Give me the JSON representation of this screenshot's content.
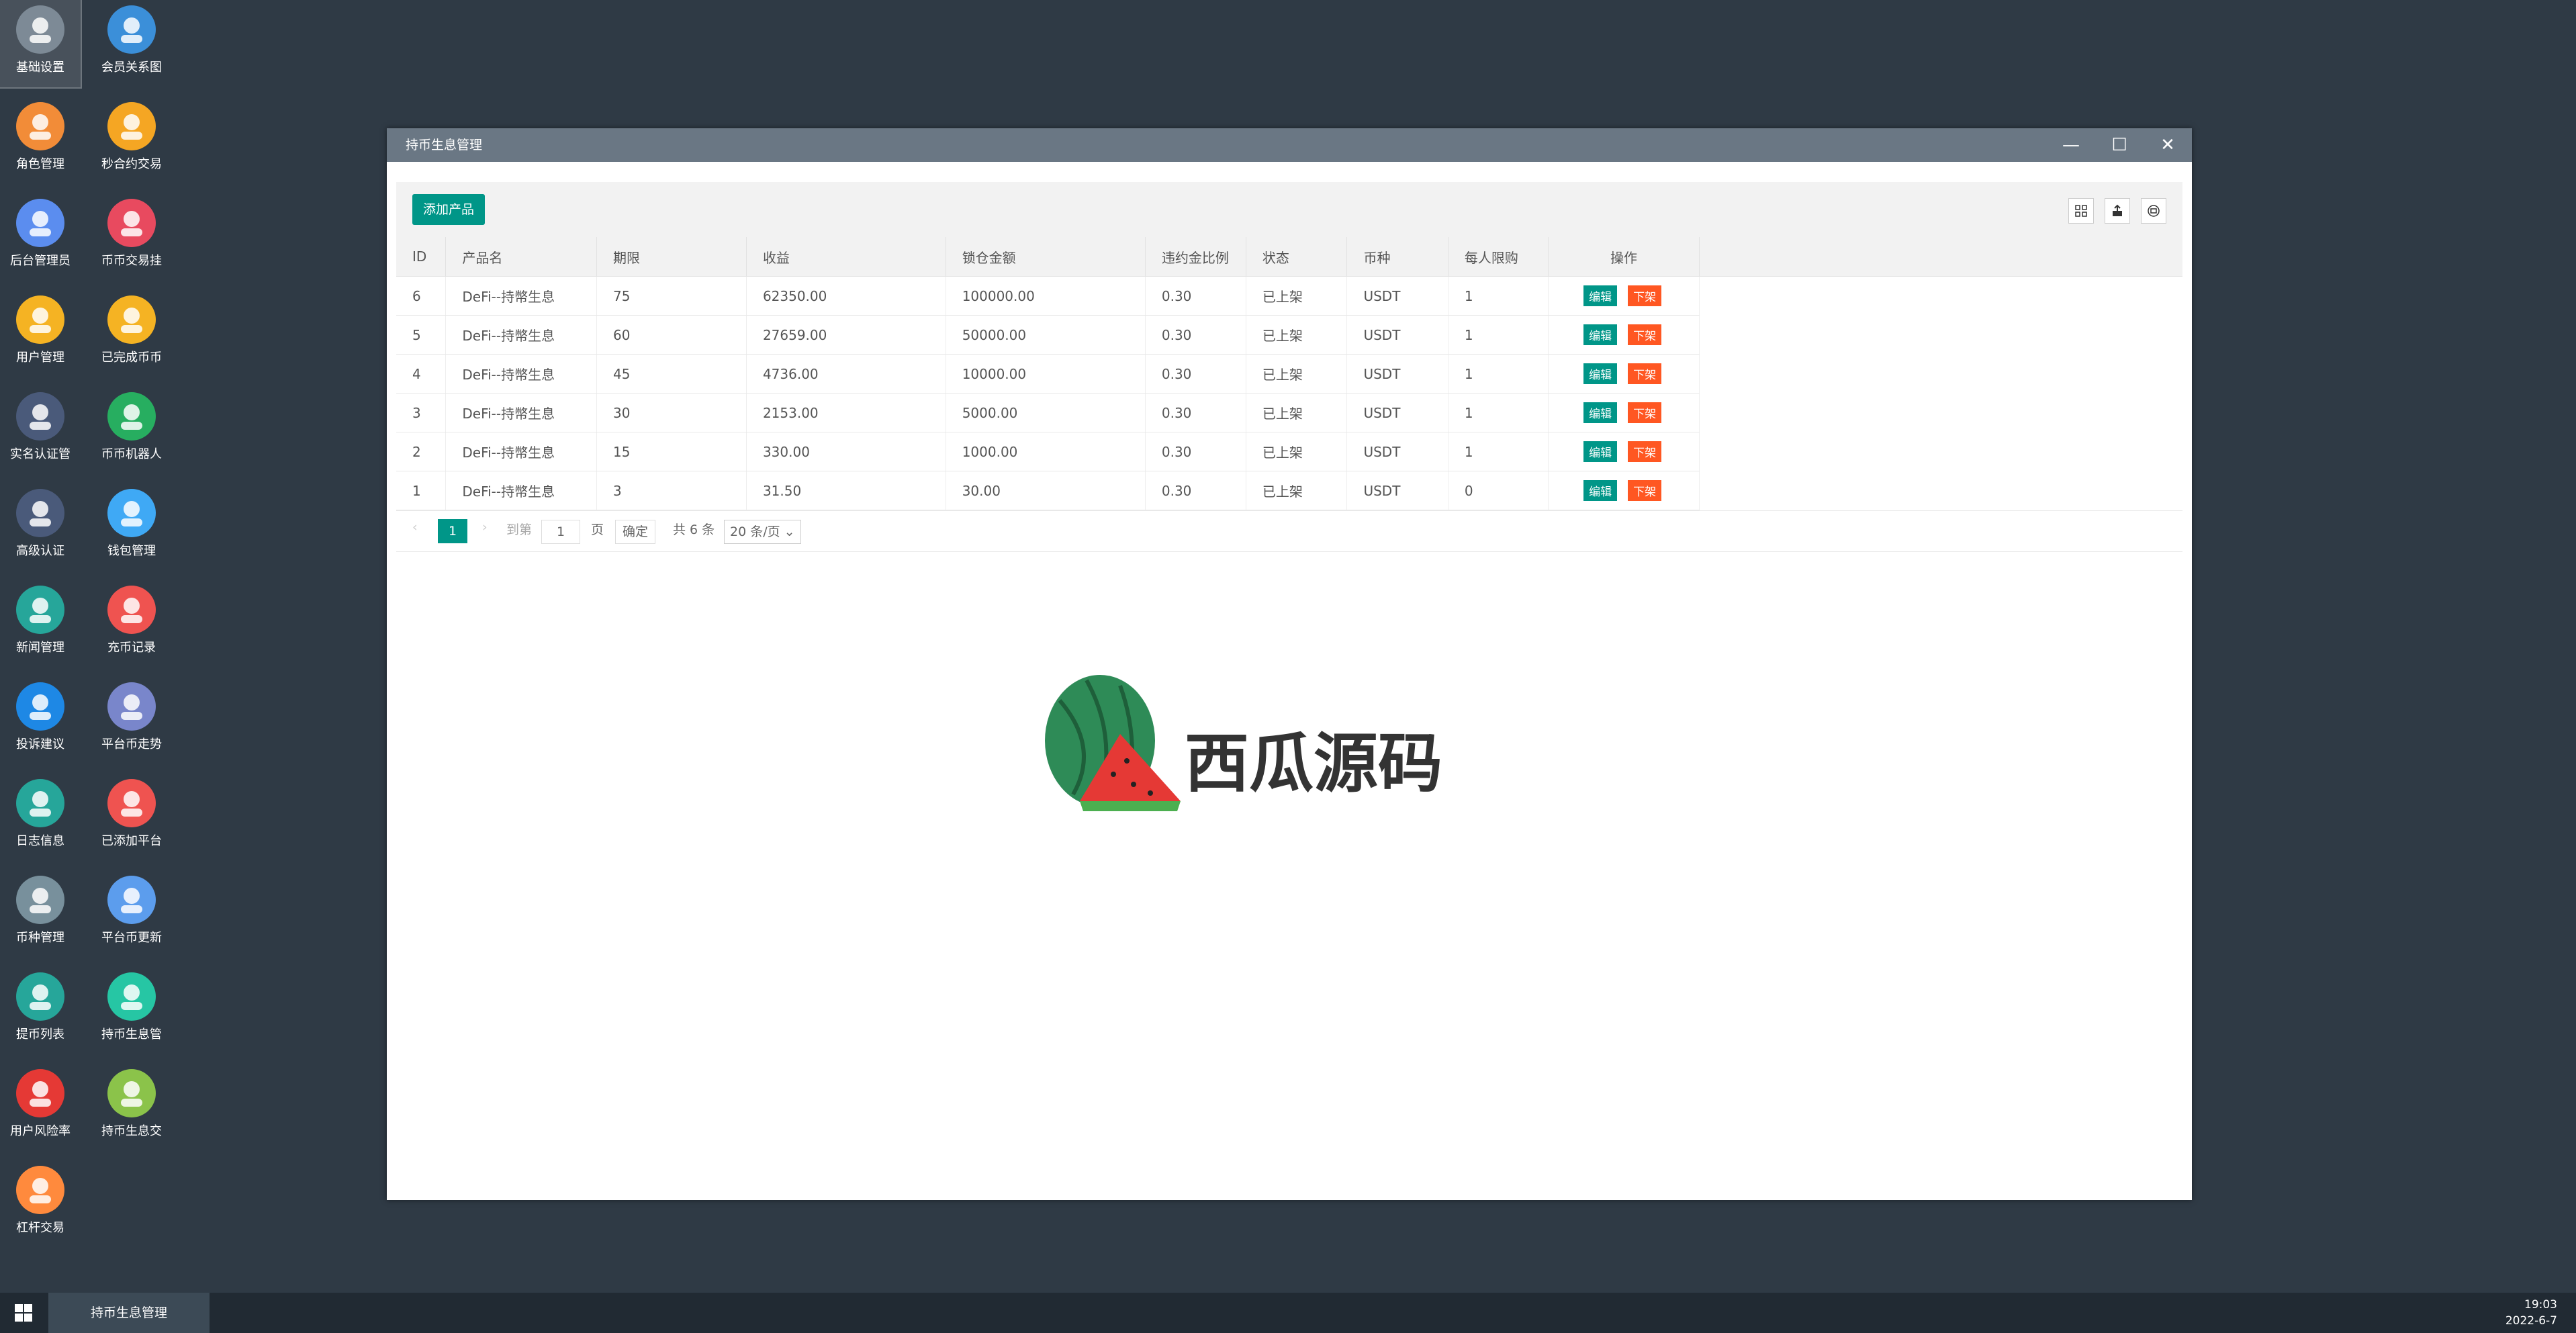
{
  "desktop_icons": [
    {
      "label": "基础设置",
      "icon": "gear-icon",
      "color": "#7d8a96"
    },
    {
      "label": "会员关系图",
      "icon": "network-icon",
      "color": "#3b8fd9"
    },
    {
      "label": "角色管理",
      "icon": "role-icon",
      "color": "#f28c38"
    },
    {
      "label": "秒合约交易",
      "icon": "stopwatch-icon",
      "color": "#f5a623"
    },
    {
      "label": "后台管理员",
      "icon": "admin-icon",
      "color": "#5b8def"
    },
    {
      "label": "币币交易挂",
      "icon": "bitcoin-icon",
      "color": "#e84a5f"
    },
    {
      "label": "用户管理",
      "icon": "user-search-icon",
      "color": "#f5b323"
    },
    {
      "label": "已完成币币",
      "icon": "check-icon",
      "color": "#f5b323"
    },
    {
      "label": "实名认证管",
      "icon": "id-verify-icon",
      "color": "#4a5a7a"
    },
    {
      "label": "币币机器人",
      "icon": "robot-icon",
      "color": "#27ae60"
    },
    {
      "label": "高级认证",
      "icon": "advanced-verify-icon",
      "color": "#4a5a7a"
    },
    {
      "label": "钱包管理",
      "icon": "wallet-icon",
      "color": "#3fa9f5"
    },
    {
      "label": "新闻管理",
      "icon": "news-icon",
      "color": "#26a69a"
    },
    {
      "label": "充币记录",
      "icon": "deposit-chart-icon",
      "color": "#ef5350"
    },
    {
      "label": "投诉建议",
      "icon": "mail-icon",
      "color": "#1e88e5"
    },
    {
      "label": "平台币走势",
      "icon": "layers-icon",
      "color": "#7986cb"
    },
    {
      "label": "日志信息",
      "icon": "log-icon",
      "color": "#26a69a"
    },
    {
      "label": "已添加平台",
      "icon": "trend-icon",
      "color": "#ef5350"
    },
    {
      "label": "币种管理",
      "icon": "dollar-icon",
      "color": "#78909c"
    },
    {
      "label": "平台币更新",
      "icon": "cloud-refresh-icon",
      "color": "#5c9ded"
    },
    {
      "label": "提币列表",
      "icon": "withdraw-icon",
      "color": "#26a69a"
    },
    {
      "label": "持币生息管",
      "icon": "unlock-icon",
      "color": "#26c6a4"
    },
    {
      "label": "用户风险率",
      "icon": "alarm-icon",
      "color": "#e53935"
    },
    {
      "label": "持币生息交",
      "icon": "hammer-icon",
      "color": "#8bc34a"
    },
    {
      "label": "杠杆交易",
      "icon": "stack-icon",
      "color": "#ff8a3d"
    }
  ],
  "window": {
    "title": "持币生息管理",
    "minimize": "—",
    "maximize": "☐",
    "close": "✕"
  },
  "toolbar": {
    "add_label": "添加产品"
  },
  "table": {
    "columns": [
      "ID",
      "产品名",
      "期限",
      "收益",
      "锁仓金额",
      "违约金比例",
      "状态",
      "币种",
      "每人限购",
      "操作"
    ],
    "rows": [
      {
        "id": "6",
        "name": "DeFi--持幣生息",
        "term": "75",
        "income": "62350.00",
        "lock": "100000.00",
        "penalty": "0.30",
        "status": "已上架",
        "coin": "USDT",
        "limit": "1"
      },
      {
        "id": "5",
        "name": "DeFi--持幣生息",
        "term": "60",
        "income": "27659.00",
        "lock": "50000.00",
        "penalty": "0.30",
        "status": "已上架",
        "coin": "USDT",
        "limit": "1"
      },
      {
        "id": "4",
        "name": "DeFi--持幣生息",
        "term": "45",
        "income": "4736.00",
        "lock": "10000.00",
        "penalty": "0.30",
        "status": "已上架",
        "coin": "USDT",
        "limit": "1"
      },
      {
        "id": "3",
        "name": "DeFi--持幣生息",
        "term": "30",
        "income": "2153.00",
        "lock": "5000.00",
        "penalty": "0.30",
        "status": "已上架",
        "coin": "USDT",
        "limit": "1"
      },
      {
        "id": "2",
        "name": "DeFi--持幣生息",
        "term": "15",
        "income": "330.00",
        "lock": "1000.00",
        "penalty": "0.30",
        "status": "已上架",
        "coin": "USDT",
        "limit": "1"
      },
      {
        "id": "1",
        "name": "DeFi--持幣生息",
        "term": "3",
        "income": "31.50",
        "lock": "30.00",
        "penalty": "0.30",
        "status": "已上架",
        "coin": "USDT",
        "limit": "0"
      }
    ],
    "edit_label": "编辑",
    "off_label": "下架"
  },
  "pager": {
    "current": "1",
    "goto_label": "到第",
    "goto_value": "1",
    "page_label": "页",
    "confirm": "确定",
    "total": "共 6 条",
    "per_page": "20 条/页"
  },
  "watermark": {
    "text": "西瓜源码"
  },
  "taskbar": {
    "task": "持币生息管理",
    "time": "19:03",
    "date": "2022-6-7"
  }
}
